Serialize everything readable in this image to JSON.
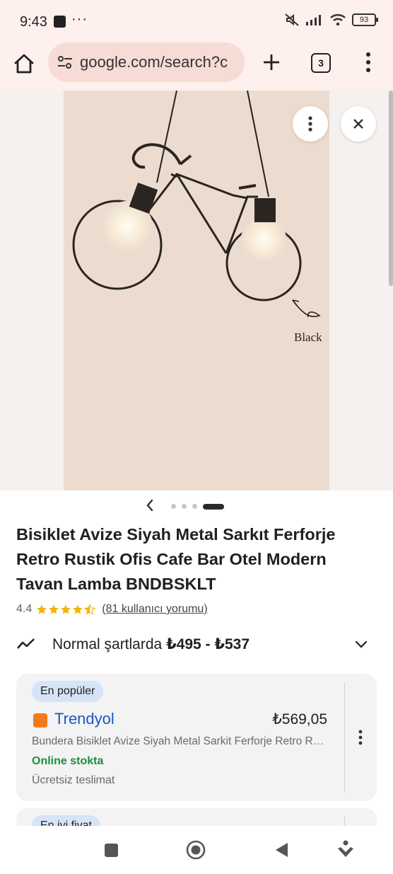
{
  "status_bar": {
    "time": "9:43",
    "dots": "···",
    "battery": "93"
  },
  "browser": {
    "url": "google.com/search?c",
    "tab_count": "3"
  },
  "image_viewer": {
    "image_label": "Black",
    "carousel": {
      "page_count": 4,
      "active_index": 3
    }
  },
  "product": {
    "title": "Bisiklet Avize Siyah Metal Sarkıt Ferforje Retro Rustik Ofis Cafe Bar Otel Modern Tavan Lamba BNDBSKLT",
    "rating": "4.4",
    "rating_value": 4.4,
    "reviews": "(81 kullanıcı yorumu)",
    "price_prefix": "Normal şartlarda ",
    "price_range": "₺495 - ₺537"
  },
  "offers": [
    {
      "badge": "En popüler",
      "store": "Trendyol",
      "price": "₺569,05",
      "description": "Bundera Bisiklet Avize Siyah Metal Sarkit Ferforje Retro Rustik Ofis Cafe Bar Otel",
      "stock": "Online stokta",
      "shipping": "Ücretsiz teslimat"
    },
    {
      "badge": "En iyi fiyat"
    }
  ],
  "colors": {
    "toolbar_bg": "#fdf0ed",
    "url_bar_bg": "#f6dcd5",
    "store_link": "#1a55c4",
    "stock_green": "#1e8e3e",
    "star": "#f4b400",
    "badge_bg": "#d6e4f7"
  }
}
